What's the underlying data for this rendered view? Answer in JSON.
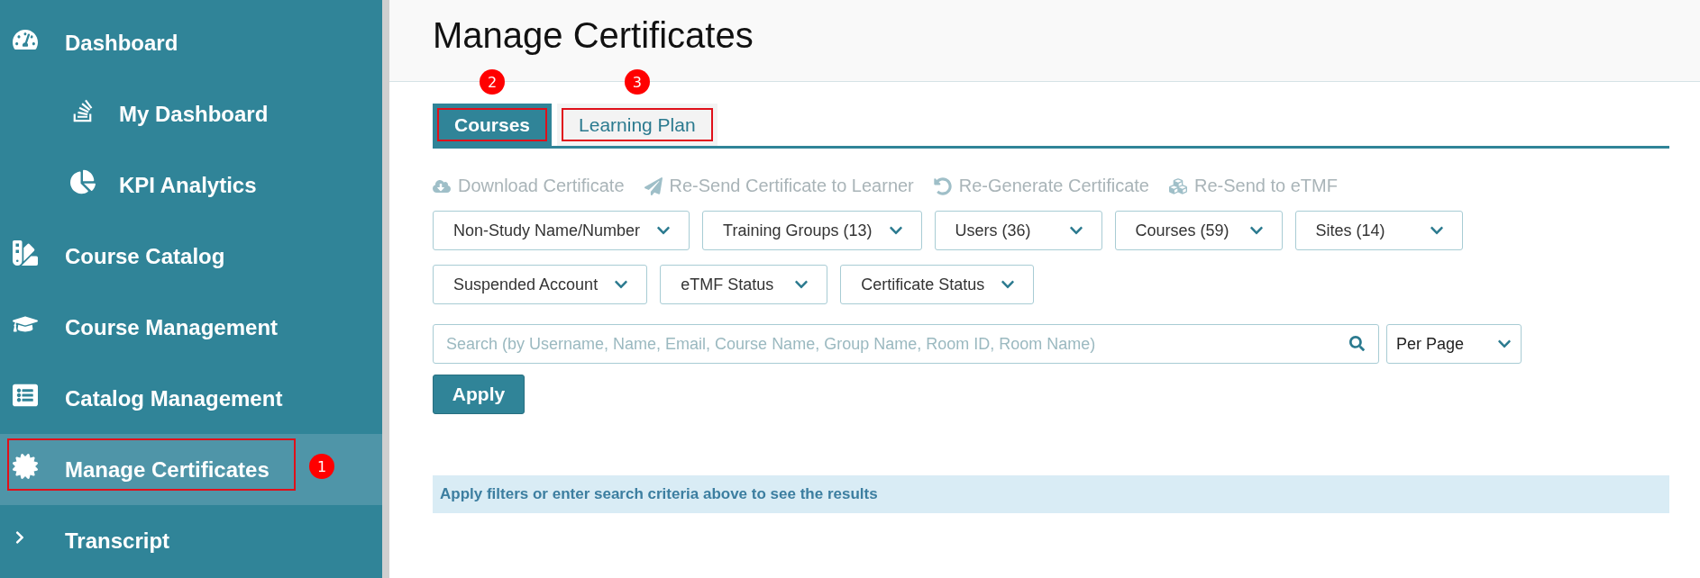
{
  "sidebar": {
    "items": [
      {
        "label": "Dashboard",
        "selected": false,
        "children": [
          {
            "label": "My Dashboard",
            "selected": false
          },
          {
            "label": "KPI Analytics",
            "selected": false
          }
        ]
      },
      {
        "label": "Course Catalog",
        "selected": false
      },
      {
        "label": "Course Management",
        "selected": false
      },
      {
        "label": "Catalog Management",
        "selected": false
      },
      {
        "label": "Manage Certificates",
        "selected": true,
        "callout": "1"
      },
      {
        "label": "Transcript",
        "selected": false,
        "expanded": false
      }
    ]
  },
  "page": {
    "title": "Manage Certificates"
  },
  "tabs": [
    {
      "label": "Courses",
      "selected": true,
      "callout": "2"
    },
    {
      "label": "Learning Plan",
      "selected": false,
      "callout": "3"
    }
  ],
  "actions": [
    {
      "label": "Download Certificate",
      "disabled": true
    },
    {
      "label": "Re-Send Certificate to Learner",
      "disabled": true
    },
    {
      "label": "Re-Generate Certificate",
      "disabled": true
    },
    {
      "label": "Re-Send to eTMF",
      "disabled": true
    }
  ],
  "filters": [
    [
      "Non-Study Name/Number",
      "Training Groups (13)",
      "Users (36)",
      "Courses (59)",
      "Sites (14)"
    ],
    [
      "Suspended Account",
      "eTMF Status",
      "Certificate Status"
    ]
  ],
  "search": {
    "placeholder": "Search (by Username, Name, Email, Course Name, Group Name, Room ID, Room Name)"
  },
  "per_page": {
    "value": "Per Page"
  },
  "apply_button": "Apply",
  "message": "Apply filters or enter search criteria above to see the results"
}
